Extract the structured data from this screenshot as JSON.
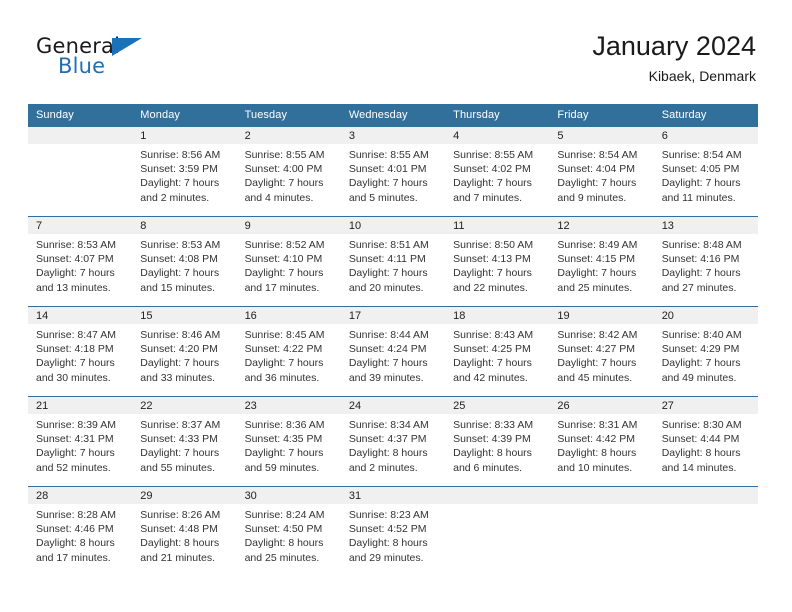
{
  "brand": {
    "name_part1": "General",
    "name_part2": "Blue",
    "accent_color": "#1b72b8"
  },
  "header": {
    "title": "January 2024",
    "subtitle": "Kibaek, Denmark"
  },
  "theme": {
    "header_bg": "#32709c",
    "row_divider": "#2e6ea4",
    "daynum_band": "#f0f0f0"
  },
  "weekday_headers": [
    "Sunday",
    "Monday",
    "Tuesday",
    "Wednesday",
    "Thursday",
    "Friday",
    "Saturday"
  ],
  "weeks": [
    [
      {
        "day": "",
        "sunrise": "",
        "sunset": "",
        "daylight1": "",
        "daylight2": ""
      },
      {
        "day": "1",
        "sunrise": "Sunrise: 8:56 AM",
        "sunset": "Sunset: 3:59 PM",
        "daylight1": "Daylight: 7 hours",
        "daylight2": "and 2 minutes."
      },
      {
        "day": "2",
        "sunrise": "Sunrise: 8:55 AM",
        "sunset": "Sunset: 4:00 PM",
        "daylight1": "Daylight: 7 hours",
        "daylight2": "and 4 minutes."
      },
      {
        "day": "3",
        "sunrise": "Sunrise: 8:55 AM",
        "sunset": "Sunset: 4:01 PM",
        "daylight1": "Daylight: 7 hours",
        "daylight2": "and 5 minutes."
      },
      {
        "day": "4",
        "sunrise": "Sunrise: 8:55 AM",
        "sunset": "Sunset: 4:02 PM",
        "daylight1": "Daylight: 7 hours",
        "daylight2": "and 7 minutes."
      },
      {
        "day": "5",
        "sunrise": "Sunrise: 8:54 AM",
        "sunset": "Sunset: 4:04 PM",
        "daylight1": "Daylight: 7 hours",
        "daylight2": "and 9 minutes."
      },
      {
        "day": "6",
        "sunrise": "Sunrise: 8:54 AM",
        "sunset": "Sunset: 4:05 PM",
        "daylight1": "Daylight: 7 hours",
        "daylight2": "and 11 minutes."
      }
    ],
    [
      {
        "day": "7",
        "sunrise": "Sunrise: 8:53 AM",
        "sunset": "Sunset: 4:07 PM",
        "daylight1": "Daylight: 7 hours",
        "daylight2": "and 13 minutes."
      },
      {
        "day": "8",
        "sunrise": "Sunrise: 8:53 AM",
        "sunset": "Sunset: 4:08 PM",
        "daylight1": "Daylight: 7 hours",
        "daylight2": "and 15 minutes."
      },
      {
        "day": "9",
        "sunrise": "Sunrise: 8:52 AM",
        "sunset": "Sunset: 4:10 PM",
        "daylight1": "Daylight: 7 hours",
        "daylight2": "and 17 minutes."
      },
      {
        "day": "10",
        "sunrise": "Sunrise: 8:51 AM",
        "sunset": "Sunset: 4:11 PM",
        "daylight1": "Daylight: 7 hours",
        "daylight2": "and 20 minutes."
      },
      {
        "day": "11",
        "sunrise": "Sunrise: 8:50 AM",
        "sunset": "Sunset: 4:13 PM",
        "daylight1": "Daylight: 7 hours",
        "daylight2": "and 22 minutes."
      },
      {
        "day": "12",
        "sunrise": "Sunrise: 8:49 AM",
        "sunset": "Sunset: 4:15 PM",
        "daylight1": "Daylight: 7 hours",
        "daylight2": "and 25 minutes."
      },
      {
        "day": "13",
        "sunrise": "Sunrise: 8:48 AM",
        "sunset": "Sunset: 4:16 PM",
        "daylight1": "Daylight: 7 hours",
        "daylight2": "and 27 minutes."
      }
    ],
    [
      {
        "day": "14",
        "sunrise": "Sunrise: 8:47 AM",
        "sunset": "Sunset: 4:18 PM",
        "daylight1": "Daylight: 7 hours",
        "daylight2": "and 30 minutes."
      },
      {
        "day": "15",
        "sunrise": "Sunrise: 8:46 AM",
        "sunset": "Sunset: 4:20 PM",
        "daylight1": "Daylight: 7 hours",
        "daylight2": "and 33 minutes."
      },
      {
        "day": "16",
        "sunrise": "Sunrise: 8:45 AM",
        "sunset": "Sunset: 4:22 PM",
        "daylight1": "Daylight: 7 hours",
        "daylight2": "and 36 minutes."
      },
      {
        "day": "17",
        "sunrise": "Sunrise: 8:44 AM",
        "sunset": "Sunset: 4:24 PM",
        "daylight1": "Daylight: 7 hours",
        "daylight2": "and 39 minutes."
      },
      {
        "day": "18",
        "sunrise": "Sunrise: 8:43 AM",
        "sunset": "Sunset: 4:25 PM",
        "daylight1": "Daylight: 7 hours",
        "daylight2": "and 42 minutes."
      },
      {
        "day": "19",
        "sunrise": "Sunrise: 8:42 AM",
        "sunset": "Sunset: 4:27 PM",
        "daylight1": "Daylight: 7 hours",
        "daylight2": "and 45 minutes."
      },
      {
        "day": "20",
        "sunrise": "Sunrise: 8:40 AM",
        "sunset": "Sunset: 4:29 PM",
        "daylight1": "Daylight: 7 hours",
        "daylight2": "and 49 minutes."
      }
    ],
    [
      {
        "day": "21",
        "sunrise": "Sunrise: 8:39 AM",
        "sunset": "Sunset: 4:31 PM",
        "daylight1": "Daylight: 7 hours",
        "daylight2": "and 52 minutes."
      },
      {
        "day": "22",
        "sunrise": "Sunrise: 8:37 AM",
        "sunset": "Sunset: 4:33 PM",
        "daylight1": "Daylight: 7 hours",
        "daylight2": "and 55 minutes."
      },
      {
        "day": "23",
        "sunrise": "Sunrise: 8:36 AM",
        "sunset": "Sunset: 4:35 PM",
        "daylight1": "Daylight: 7 hours",
        "daylight2": "and 59 minutes."
      },
      {
        "day": "24",
        "sunrise": "Sunrise: 8:34 AM",
        "sunset": "Sunset: 4:37 PM",
        "daylight1": "Daylight: 8 hours",
        "daylight2": "and 2 minutes."
      },
      {
        "day": "25",
        "sunrise": "Sunrise: 8:33 AM",
        "sunset": "Sunset: 4:39 PM",
        "daylight1": "Daylight: 8 hours",
        "daylight2": "and 6 minutes."
      },
      {
        "day": "26",
        "sunrise": "Sunrise: 8:31 AM",
        "sunset": "Sunset: 4:42 PM",
        "daylight1": "Daylight: 8 hours",
        "daylight2": "and 10 minutes."
      },
      {
        "day": "27",
        "sunrise": "Sunrise: 8:30 AM",
        "sunset": "Sunset: 4:44 PM",
        "daylight1": "Daylight: 8 hours",
        "daylight2": "and 14 minutes."
      }
    ],
    [
      {
        "day": "28",
        "sunrise": "Sunrise: 8:28 AM",
        "sunset": "Sunset: 4:46 PM",
        "daylight1": "Daylight: 8 hours",
        "daylight2": "and 17 minutes."
      },
      {
        "day": "29",
        "sunrise": "Sunrise: 8:26 AM",
        "sunset": "Sunset: 4:48 PM",
        "daylight1": "Daylight: 8 hours",
        "daylight2": "and 21 minutes."
      },
      {
        "day": "30",
        "sunrise": "Sunrise: 8:24 AM",
        "sunset": "Sunset: 4:50 PM",
        "daylight1": "Daylight: 8 hours",
        "daylight2": "and 25 minutes."
      },
      {
        "day": "31",
        "sunrise": "Sunrise: 8:23 AM",
        "sunset": "Sunset: 4:52 PM",
        "daylight1": "Daylight: 8 hours",
        "daylight2": "and 29 minutes."
      },
      {
        "day": "",
        "sunrise": "",
        "sunset": "",
        "daylight1": "",
        "daylight2": ""
      },
      {
        "day": "",
        "sunrise": "",
        "sunset": "",
        "daylight1": "",
        "daylight2": ""
      },
      {
        "day": "",
        "sunrise": "",
        "sunset": "",
        "daylight1": "",
        "daylight2": ""
      }
    ]
  ]
}
